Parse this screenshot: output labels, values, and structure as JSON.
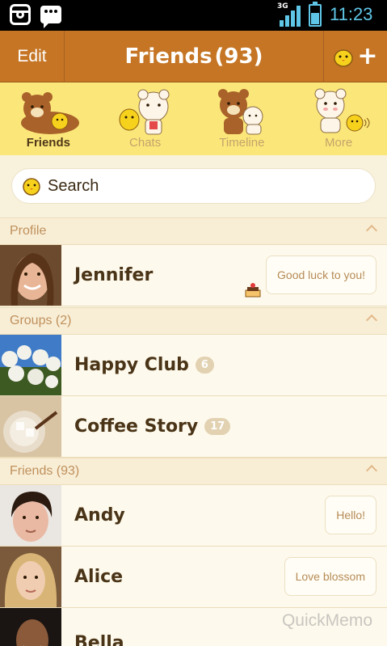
{
  "status_bar": {
    "network": "3G",
    "time": "11:23",
    "battery_level": 0.6,
    "icons": [
      "instagram-icon",
      "message-icon",
      "signal-icon",
      "battery-icon"
    ]
  },
  "header": {
    "edit_label": "Edit",
    "title": "Friends",
    "count": "(93)",
    "add_icon": "add-friend-icon",
    "bar_color": "#c57524"
  },
  "tabs": [
    {
      "label": "Friends",
      "active": true,
      "icon": "bear-chick-icon"
    },
    {
      "label": "Chats",
      "active": false,
      "icon": "chick-bear-icon"
    },
    {
      "label": "Timeline",
      "active": false,
      "icon": "bears-icon"
    },
    {
      "label": "More",
      "active": false,
      "icon": "bear-chick-more-icon"
    }
  ],
  "search": {
    "label": "Search",
    "icon": "chick-icon"
  },
  "sections": {
    "profile": {
      "label": "Profile"
    },
    "groups": {
      "label": "Groups (2)"
    },
    "friends": {
      "label": "Friends (93)"
    }
  },
  "profile": {
    "name": "Jennifer",
    "status": "Good luck to you!"
  },
  "groups": [
    {
      "name": "Happy Club",
      "count": "6"
    },
    {
      "name": "Coffee Story",
      "count": "17"
    }
  ],
  "friends": [
    {
      "name": "Andy",
      "status": "Hello!"
    },
    {
      "name": "Alice",
      "status": "Love blossom"
    },
    {
      "name": "Bella",
      "status": ""
    }
  ],
  "watermark": "QuickMemo",
  "colors": {
    "accent": "#c57524",
    "tab_bar": "#fbe779",
    "background": "#fbf6e6"
  }
}
